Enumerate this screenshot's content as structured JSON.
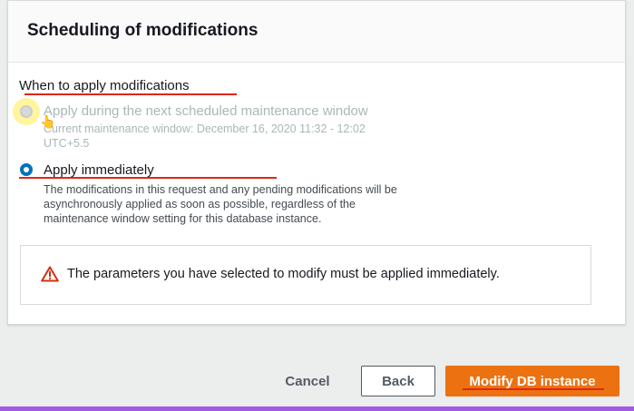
{
  "panel": {
    "title": "Scheduling of modifications"
  },
  "section": {
    "label": "When to apply modifications"
  },
  "options": [
    {
      "label": "Apply during the next scheduled maintenance window",
      "description_line1": "Current maintenance window: December 16, 2020 11:32 - 12:02",
      "description_line2": "UTC+5.5",
      "selected": false,
      "disabled": true
    },
    {
      "label": "Apply immediately",
      "description_line1": "The modifications in this request and any pending modifications will be",
      "description_line2": "asynchronously applied as soon as possible, regardless of the",
      "description_line3": "maintenance window setting for this database instance.",
      "selected": true,
      "disabled": false
    }
  ],
  "alert": {
    "icon": "warning-icon",
    "text": "The parameters you have selected to modify must be applied immediately."
  },
  "footer": {
    "cancel_label": "Cancel",
    "back_label": "Back",
    "primary_label": "Modify DB instance"
  },
  "colors": {
    "primary": "#ec7211",
    "selected_radio": "#0073bb",
    "annotation_underline": "#e0261a",
    "warning": "#d13212"
  }
}
